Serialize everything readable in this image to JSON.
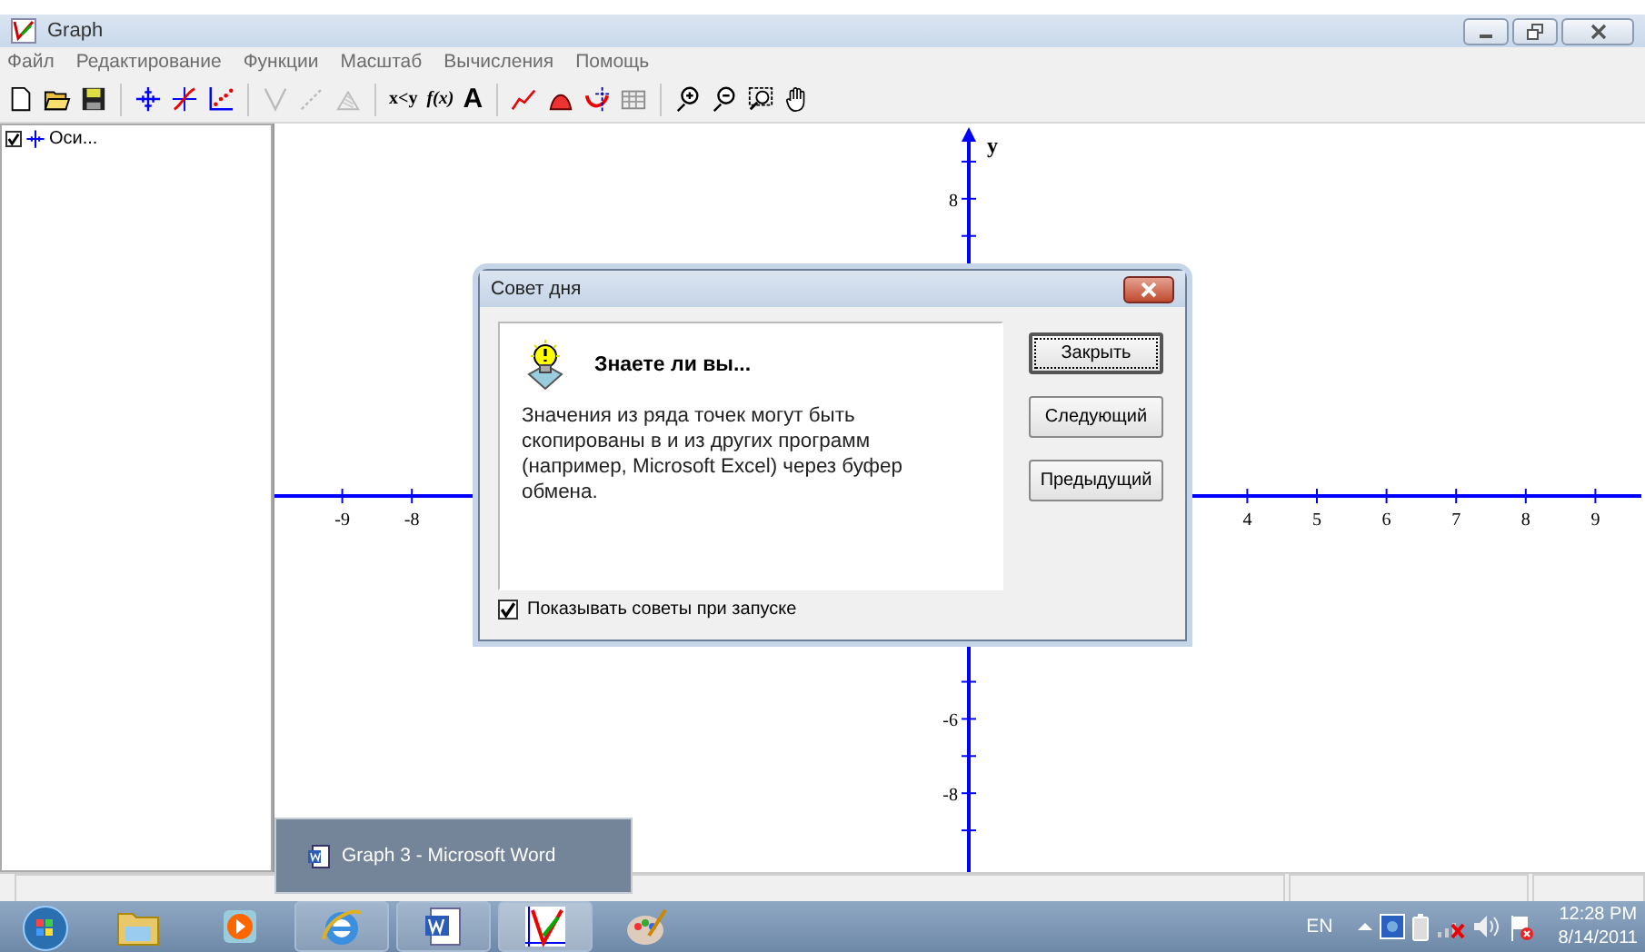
{
  "window": {
    "title": "Graph"
  },
  "menu": [
    "Файл",
    "Редактирование",
    "Функции",
    "Масштаб",
    "Вычисления",
    "Помощь"
  ],
  "toolbar_text_buttons": [
    "x<y",
    "f(x)",
    "A"
  ],
  "tree": [
    {
      "label": "Оси...",
      "checked": true
    }
  ],
  "plane": {
    "y_axis_label": "y",
    "x_ticks": [
      "-9",
      "-8",
      "4",
      "5",
      "6",
      "7",
      "8",
      "9"
    ],
    "y_ticks": [
      "8",
      "-6",
      "-8"
    ]
  },
  "dialog": {
    "title": "Совет дня",
    "heading": "Знаете ли вы...",
    "body": "Значения из ряда точек могут быть скопированы в и из других программ (например, Microsoft Excel) через буфер обмена.",
    "buttons": [
      {
        "label": "Закрыть",
        "focused": true
      },
      {
        "label": "Следующий",
        "focused": false
      },
      {
        "label": "Предыдущий",
        "focused": false
      }
    ],
    "show_on_startup": {
      "label": "Показывать советы при запуске",
      "checked": true
    }
  },
  "taskbar_preview": {
    "label": "Graph 3 - Microsoft Word"
  },
  "tray": {
    "language": "EN",
    "time": "12:28 PM",
    "date": "8/14/2011"
  }
}
